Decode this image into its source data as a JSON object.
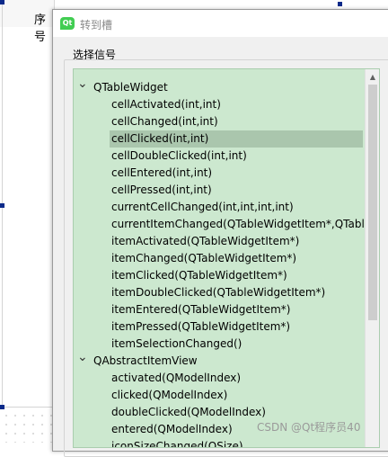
{
  "background": {
    "header_text": "序号"
  },
  "dialog": {
    "title": "转到槽",
    "app_icon_text": "Qt",
    "group_label": "选择信号",
    "tree": {
      "groups": [
        {
          "name": "QTableWidget",
          "expanded": true,
          "items": [
            "cellActivated(int,int)",
            "cellChanged(int,int)",
            "cellClicked(int,int)",
            "cellDoubleClicked(int,int)",
            "cellEntered(int,int)",
            "cellPressed(int,int)",
            "currentCellChanged(int,int,int,int)",
            "currentItemChanged(QTableWidgetItem*,QTable",
            "itemActivated(QTableWidgetItem*)",
            "itemChanged(QTableWidgetItem*)",
            "itemClicked(QTableWidgetItem*)",
            "itemDoubleClicked(QTableWidgetItem*)",
            "itemEntered(QTableWidgetItem*)",
            "itemPressed(QTableWidgetItem*)",
            "itemSelectionChanged()"
          ]
        },
        {
          "name": "QAbstractItemView",
          "expanded": true,
          "items": [
            "activated(QModelIndex)",
            "clicked(QModelIndex)",
            "doubleClicked(QModelIndex)",
            "entered(QModelIndex)",
            "iconSizeChanged(QSize)"
          ]
        }
      ],
      "selected_item": "cellClicked(int,int)"
    }
  },
  "watermark": "CSDN @Qt程序员40",
  "colors": {
    "tree_background": "#cce8cf",
    "selected_row": "#aac6ad",
    "qt_green": "#41cd52"
  }
}
